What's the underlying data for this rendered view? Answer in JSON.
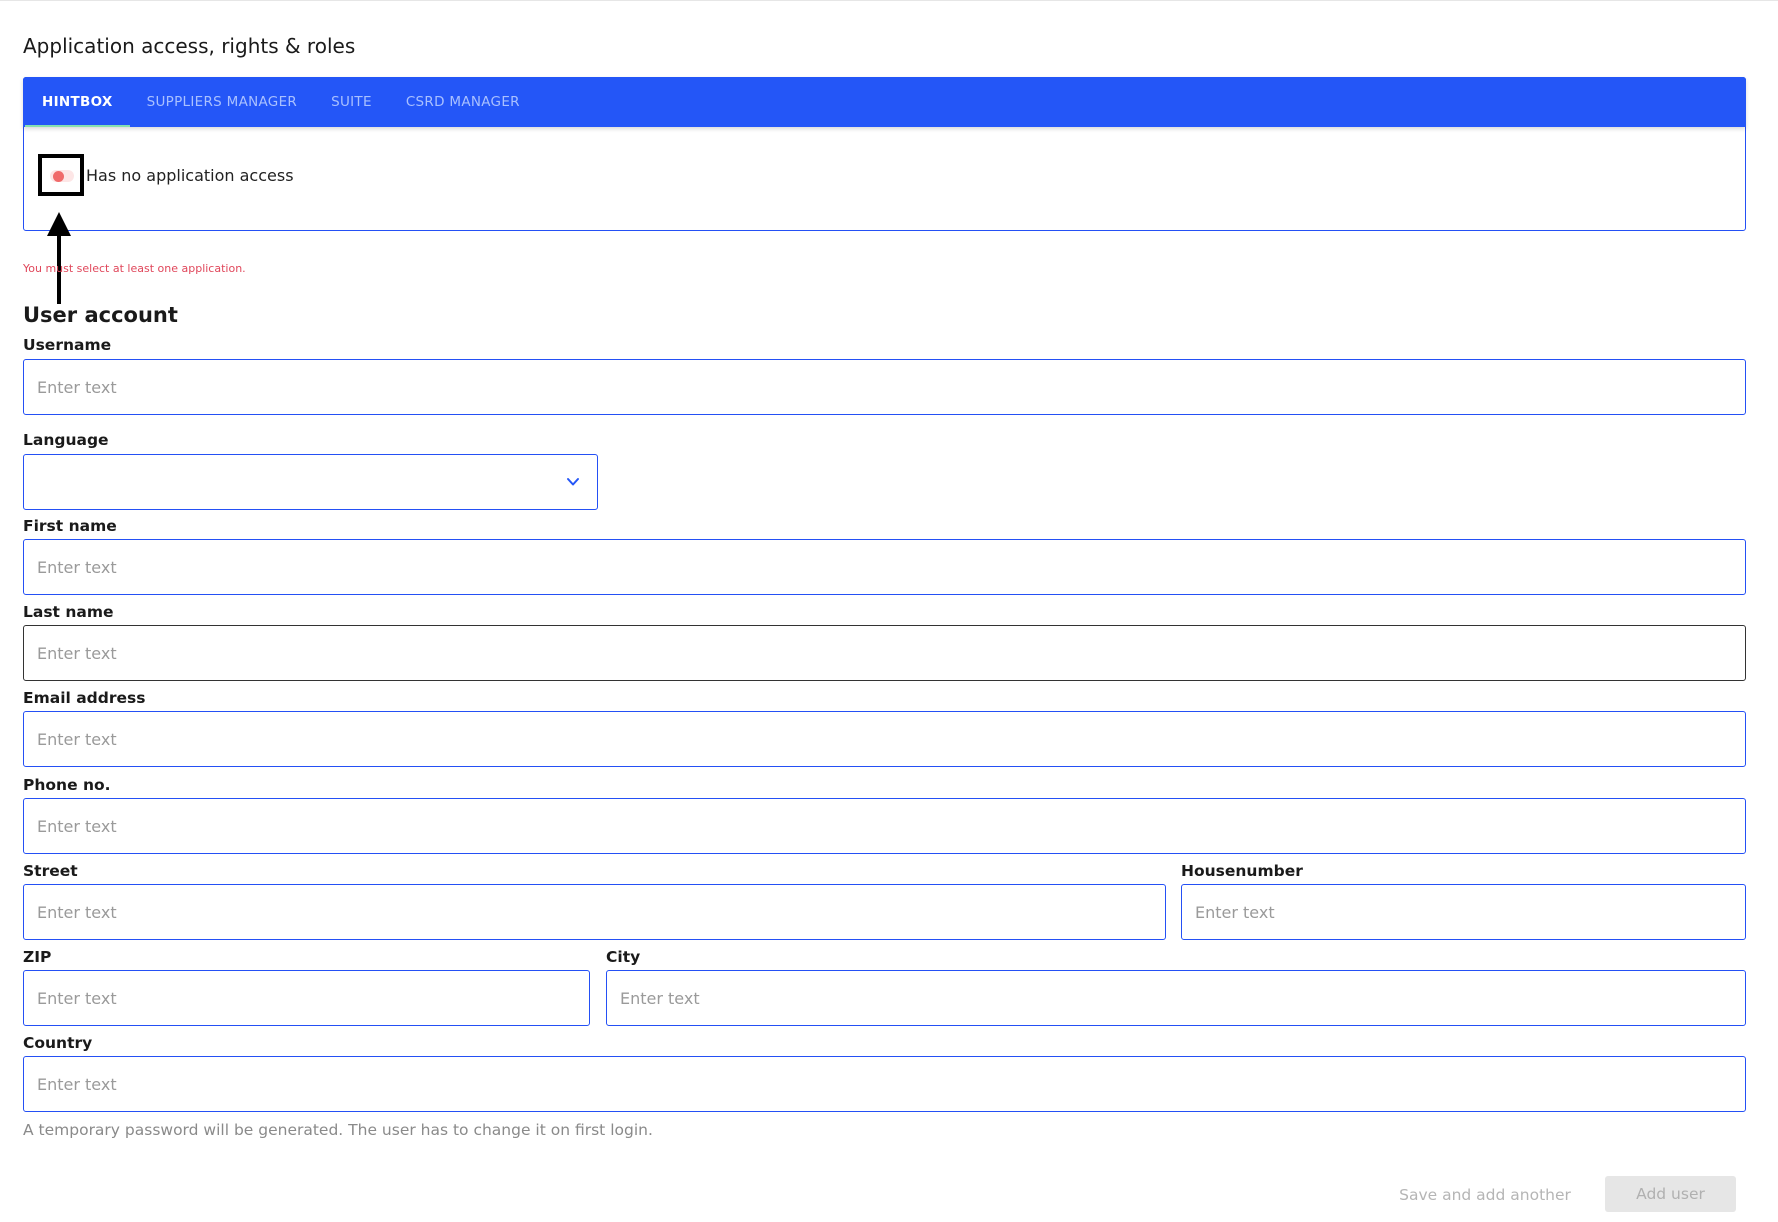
{
  "access": {
    "title": "Application access, rights & roles",
    "tabs": [
      {
        "label": "HINTBOX"
      },
      {
        "label": "SUPPLIERS MANAGER"
      },
      {
        "label": "SUITE"
      },
      {
        "label": "CSRD MANAGER"
      }
    ],
    "active_tab": "HINTBOX",
    "toggle_label": "Has no application access",
    "toggle_on": false,
    "error": "You must select at least one application."
  },
  "user_account": {
    "title": "User account",
    "username": {
      "label": "Username",
      "placeholder": "Enter text",
      "value": ""
    },
    "language": {
      "label": "Language",
      "value": ""
    },
    "first_name": {
      "label": "First name",
      "placeholder": "Enter text",
      "value": ""
    },
    "last_name": {
      "label": "Last name",
      "placeholder": "Enter text",
      "value": ""
    },
    "email": {
      "label": "Email address",
      "placeholder": "Enter text",
      "value": ""
    },
    "phone": {
      "label": "Phone no.",
      "placeholder": "Enter text",
      "value": ""
    },
    "street": {
      "label": "Street",
      "placeholder": "Enter text",
      "value": ""
    },
    "housenumber": {
      "label": "Housenumber",
      "placeholder": "Enter text",
      "value": ""
    },
    "zip": {
      "label": "ZIP",
      "placeholder": "Enter text",
      "value": ""
    },
    "city": {
      "label": "City",
      "placeholder": "Enter text",
      "value": ""
    },
    "country": {
      "label": "Country",
      "placeholder": "Enter text",
      "value": ""
    },
    "password_hint": "A temporary password will be generated. The user has to change it on first login."
  },
  "actions": {
    "save_and_add_another": "Save and add another",
    "add_user": "Add user"
  },
  "colors": {
    "accent": "#2456f7",
    "error": "#e0475b",
    "tab_inactive": "#a9c0ff",
    "active_tab_underline": "#86e0b0"
  }
}
